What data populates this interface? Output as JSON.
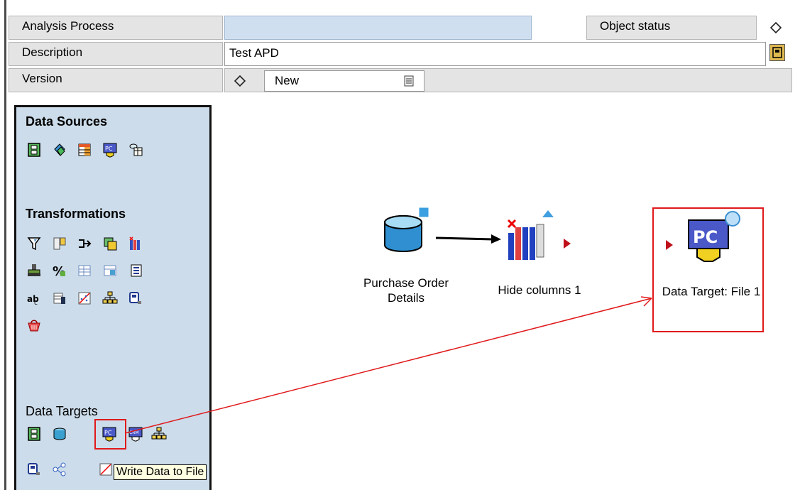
{
  "header": {
    "analysis_process_label": "Analysis Process",
    "analysis_process_value": "",
    "object_status_label": "Object status",
    "object_status_icon": "diamond-icon",
    "description_label": "Description",
    "description_value": "Test APD",
    "version_label": "Version",
    "version_icon": "diamond-icon",
    "version_value": "New"
  },
  "palette": {
    "sections": [
      {
        "title": "Data Sources"
      },
      {
        "title": "Transformations"
      },
      {
        "title": "Data Targets"
      }
    ],
    "tooltip": "Write Data to File"
  },
  "canvas": {
    "nodes": [
      {
        "label_line1": "Purchase Order",
        "label_line2": "Details"
      },
      {
        "label": "Hide columns 1"
      },
      {
        "label": "Data Target: File 1"
      }
    ]
  },
  "colors": {
    "palette_bg": "#ccdcea",
    "highlight_red": "#e0191b",
    "field_blue": "#d0dff0"
  }
}
